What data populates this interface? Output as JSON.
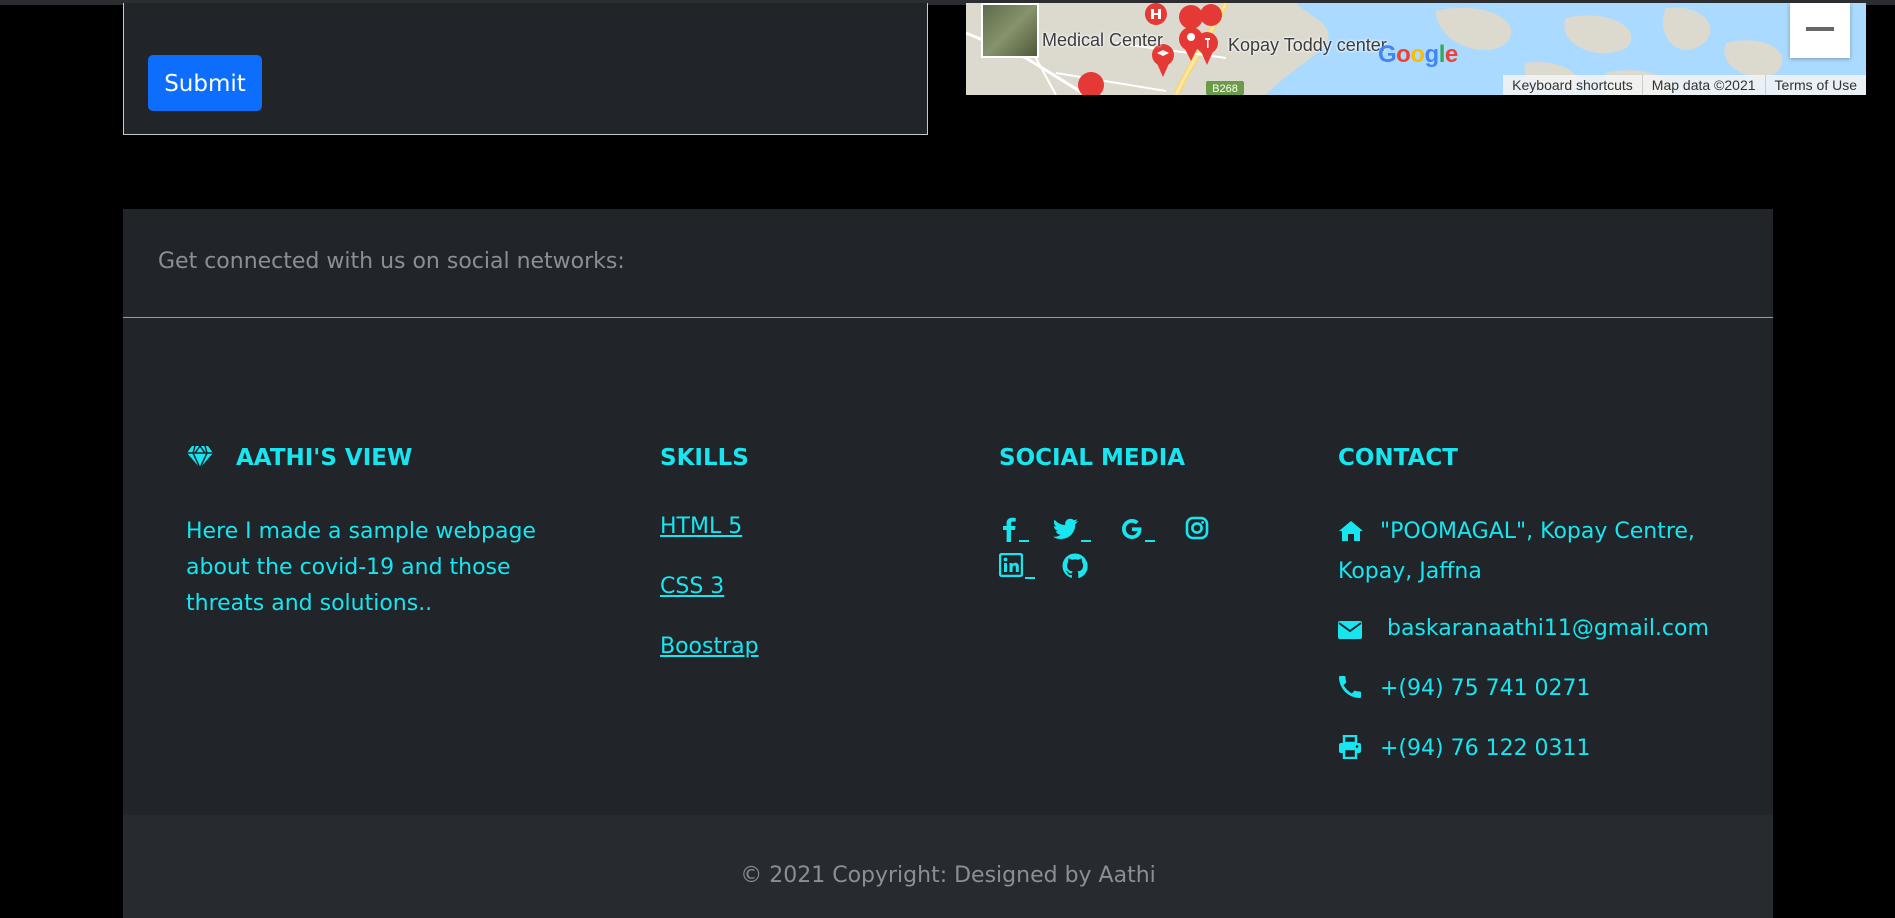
{
  "form": {
    "submit_label": "Submit"
  },
  "map": {
    "labels": {
      "medical_center": "Medical Center",
      "toddy_center": "Kopay Toddy center",
      "road": "B268"
    },
    "google_logo": [
      "G",
      "o",
      "o",
      "g",
      "l",
      "e"
    ],
    "google_colors": [
      "#4285F4",
      "#EA4335",
      "#FBBC05",
      "#4285F4",
      "#34A853",
      "#EA4335"
    ],
    "attribution": {
      "shortcuts": "Keyboard shortcuts",
      "data": "Map data ©2021",
      "terms": "Terms of Use"
    },
    "zoom_out_icon": "minus-icon"
  },
  "footer": {
    "social_prompt": "Get connected with us on social networks:",
    "brand": {
      "icon": "gem-icon",
      "title": "AATHI'S VIEW",
      "description": "Here I made a sample webpage about the covid-19 and those threats and solutions.."
    },
    "skills": {
      "title": "SKILLS",
      "links": [
        "HTML 5",
        "CSS 3",
        "Boostrap"
      ]
    },
    "social_media": {
      "title": "SOCIAL MEDIA",
      "icons": [
        "facebook-icon",
        "twitter-icon",
        "google-icon",
        "instagram-icon",
        "linkedin-icon",
        "github-icon"
      ]
    },
    "contact": {
      "title": "CONTACT",
      "address": "\"POOMAGAL\", Kopay Centre, Kopay, Jaffna",
      "email": "baskaranaathi11@gmail.com",
      "phone": "+(94) 75 741 0271",
      "fax": "+(94) 76 122 0311"
    },
    "copyright": "© 2021 Copyright: Designed by Aathi"
  },
  "colors": {
    "accent": "#17e6f0",
    "footer_bg": "#212529",
    "copyright_bg": "#272b30",
    "button": "#0d6efd",
    "muted_text": "#8a8f95"
  }
}
